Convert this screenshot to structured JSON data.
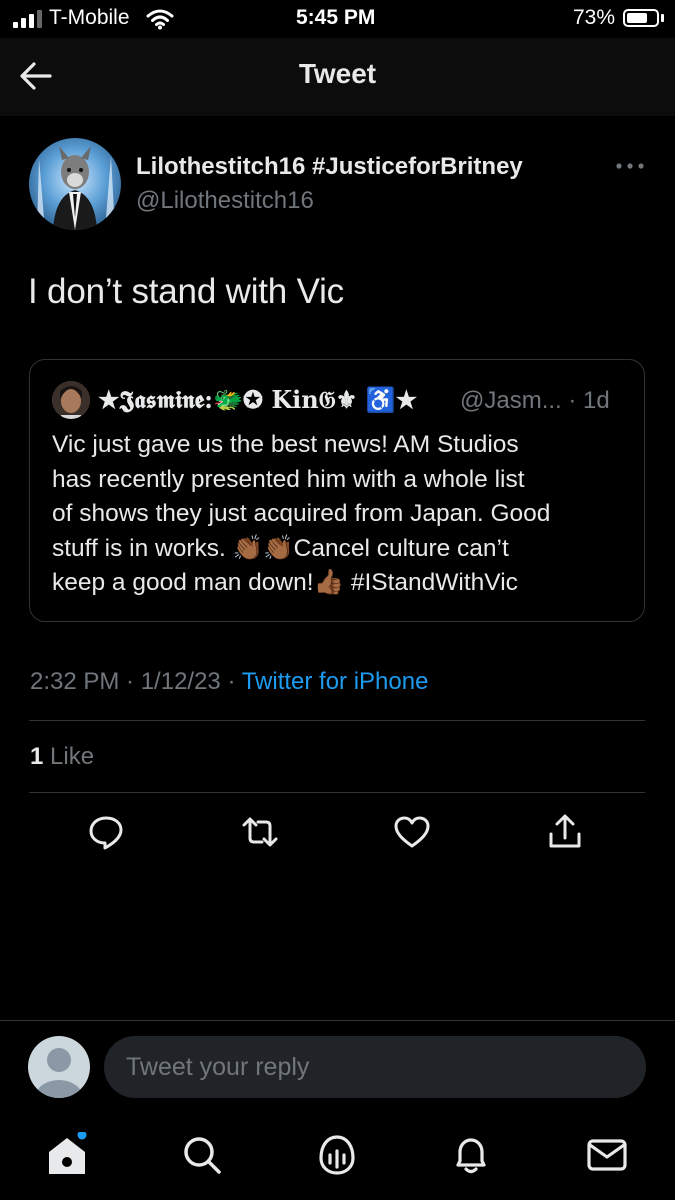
{
  "status_bar": {
    "carrier": "T-Mobile",
    "time": "5:45 PM",
    "battery": "73%",
    "battery_level": 0.73
  },
  "header": {
    "title": "Tweet",
    "back_icon": "back-arrow-icon"
  },
  "tweet": {
    "author_name": "Lilothestitch16 #JusticeforBritney",
    "author_handle": "@Lilothestitch16",
    "text": "I don’t stand with Vic",
    "more_icon": "more-dots-icon",
    "timestamp": "2:32 PM · 1/12/23",
    "separator": " · ",
    "source": "Twitter for iPhone",
    "like_count": "1",
    "like_label": "Like"
  },
  "quote_tweet": {
    "author_name": "★𝕵𝖆𝖘𝖒𝖎𝖓𝖊:🐲✪ Kin𝔊⚜ ♿★",
    "author_handle_time": "@Jasm... · 1d",
    "lines": [
      "Vic just gave us the best news! AM Studios",
      "has recently presented him with a whole list",
      "of shows they just acquired from Japan. Good",
      "stuff is in works. 👏🏾👏🏾Cancel culture can’t",
      "keep a good man down!👍🏾 #IStandWithVic"
    ]
  },
  "actions": [
    "reply-icon",
    "retweet-icon",
    "like-icon",
    "share-icon"
  ],
  "reply": {
    "placeholder": "Tweet your reply"
  },
  "tab_bar": [
    "home-icon",
    "search-icon",
    "spaces-icon",
    "notifications-icon",
    "messages-icon"
  ],
  "colors": {
    "background": "#000000",
    "accent": "#1d9bf0",
    "secondary_text": "#71767b",
    "border": "#2f3336"
  }
}
